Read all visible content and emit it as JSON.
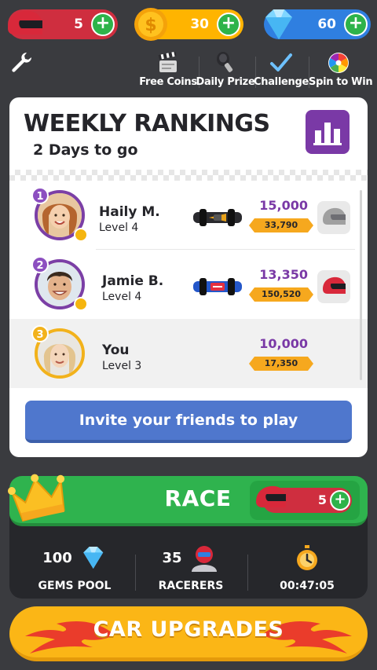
{
  "currency": {
    "lives": {
      "value": "5",
      "plus": "+"
    },
    "coins": {
      "value": "30",
      "plus": "+",
      "symbol": "$"
    },
    "gems": {
      "value": "60",
      "plus": "+"
    }
  },
  "nav": [
    {
      "label": "Free Coins",
      "icon": "clapperboard-icon"
    },
    {
      "label": "Daily Prize",
      "icon": "key-icon"
    },
    {
      "label": "Challenge",
      "icon": "checkmark-icon"
    },
    {
      "label": "Spin to Win",
      "icon": "color-wheel-icon"
    }
  ],
  "rankings": {
    "title": "WEEKLY RANKINGS",
    "subtitle": "2 Days to go",
    "players": [
      {
        "rank": "1",
        "name": "Haily M.",
        "level": "Level 4",
        "score": "15,000",
        "coins": "33,790",
        "helmet_color": "#a0a0a0"
      },
      {
        "rank": "2",
        "name": "Jamie B.",
        "level": "Level 4",
        "score": "13,350",
        "coins": "150,520",
        "helmet_color": "#d8283a"
      },
      {
        "rank": "3",
        "name": "You",
        "level": "Level 3",
        "score": "10,000",
        "coins": "17,350"
      }
    ],
    "invite_label": "Invite your friends to play"
  },
  "race": {
    "label": "RACE",
    "cost": "5",
    "plus": "+",
    "stats": [
      {
        "value": "100",
        "label": "GEMS POOL",
        "icon": "gem-icon"
      },
      {
        "value": "35",
        "label": "RACERERS",
        "icon": "racer-icon"
      },
      {
        "value": "",
        "label": "00:47:05",
        "icon": "stopwatch-icon"
      }
    ]
  },
  "upgrades_label": "CAR UPGRADES",
  "colors": {
    "background": "#3a3b3f",
    "accent_purple": "#7a39a6",
    "race_green": "#2fb34e",
    "invite_blue": "#4f77cd",
    "upgrade_orange": "#fbb616"
  }
}
